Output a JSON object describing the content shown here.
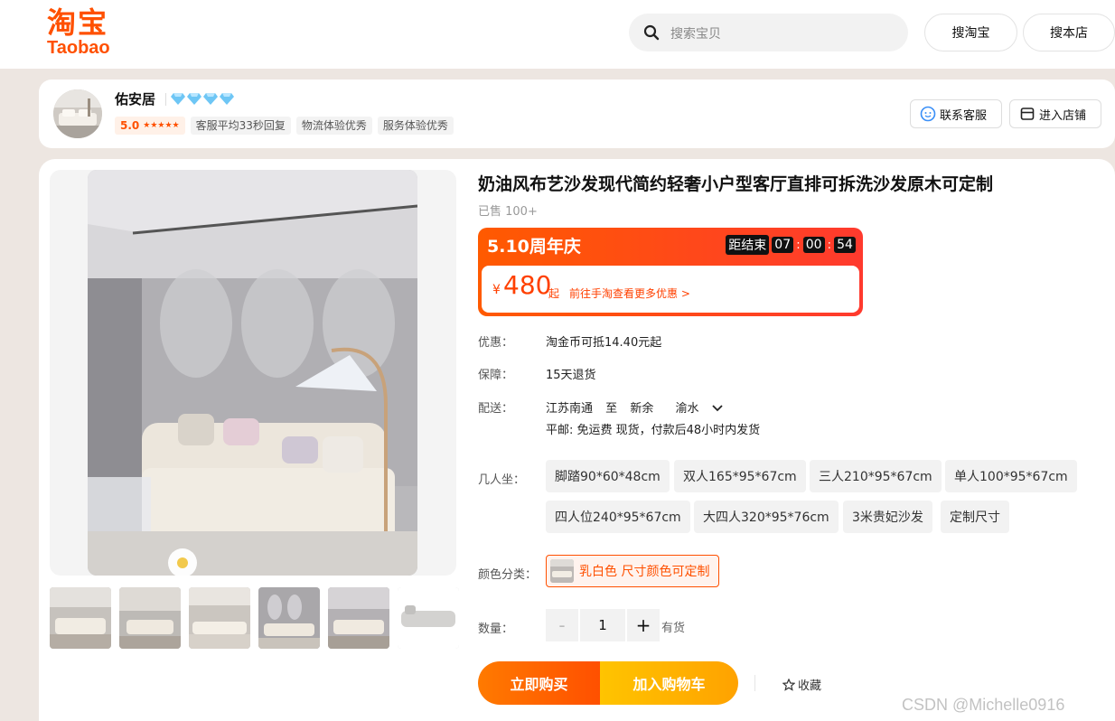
{
  "header": {
    "logo_cn": "淘宝",
    "logo_en": "Taobao",
    "search_placeholder": "搜索宝贝",
    "search_taobao_label": "搜淘宝",
    "search_shop_label": "搜本店",
    "brand_color": "#ff5000"
  },
  "shop": {
    "name": "佑安居",
    "diamond_count": 4,
    "score": "5.0",
    "stars": "★★★★★",
    "tags": [
      "客服平均33秒回复",
      "物流体验优秀",
      "服务体验优秀"
    ],
    "contact_label": "联系客服",
    "enter_label": "进入店铺"
  },
  "product": {
    "title": "奶油风布艺沙发现代简约轻奢小户型客厅直排可拆洗沙发原木可定制",
    "sold": "已售 100+",
    "promo": {
      "event": "5.10周年庆",
      "countdown_label": "距结束",
      "hours": "07",
      "minutes": "00",
      "seconds": "54",
      "currency": "¥",
      "price": "480",
      "price_suffix": "起",
      "more_link": "前往手淘查看更多优惠 >"
    },
    "discount_label": "优惠：",
    "discount_value": "淘金币可抵14.40元起",
    "guarantee_label": "保障：",
    "guarantee_value": "15天退货",
    "shipping_label": "配送：",
    "ship_from": "江苏南通",
    "ship_to_word": "至",
    "ship_city": "新余",
    "ship_district": "渝水",
    "ship_note": "平邮: 免运费  现货，付款后48小时内发货",
    "seats_label": "几人坐：",
    "seat_options": [
      "脚踏90*60*48cm",
      "双人165*95*67cm",
      "三人210*95*67cm",
      "单人100*95*67cm",
      "四人位240*95*67cm",
      "大四人320*95*76cm",
      "3米贵妃沙发",
      "定制尺寸"
    ],
    "color_label": "颜色分类：",
    "color_option": "乳白色 尺寸颜色可定制",
    "qty_label": "数量：",
    "qty_minus": "-",
    "qty_value": "1",
    "qty_plus": "+",
    "stock": "有货",
    "buy_now": "立即购买",
    "add_cart": "加入购物车",
    "favorite": "收藏"
  },
  "watermark": "CSDN @Michelle0916"
}
